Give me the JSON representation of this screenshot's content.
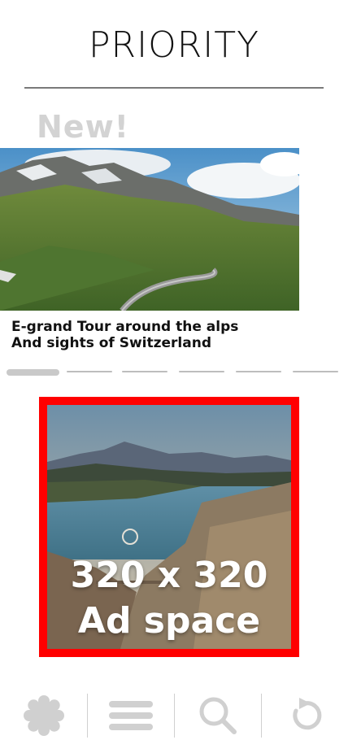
{
  "header": {
    "brand": "PRIORITY"
  },
  "featured": {
    "badge": "New!",
    "caption_line1": "E-grand Tour around the alps",
    "caption_line2": "And sights of Switzerland",
    "carousel": {
      "total_slides": 6,
      "active_index": 0
    }
  },
  "ad": {
    "line1": "320 x 320",
    "line2": "Ad space",
    "border_color": "#ff0000"
  },
  "nav": {
    "items": [
      {
        "icon": "badge-icon"
      },
      {
        "icon": "menu-icon"
      },
      {
        "icon": "search-icon"
      },
      {
        "icon": "refresh-icon"
      }
    ],
    "icon_color": "#d0d0d0"
  }
}
